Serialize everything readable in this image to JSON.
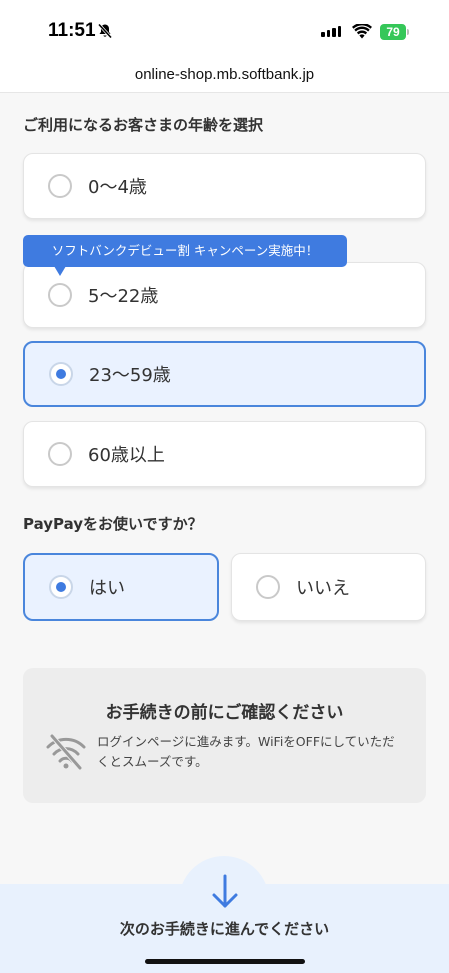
{
  "status_bar": {
    "time": "11:51",
    "battery": "79"
  },
  "browser": {
    "url": "online-shop.mb.softbank.jp"
  },
  "age_section": {
    "title": "ご利用になるお客さまの年齢を選択",
    "options": [
      {
        "label": "0〜4歳",
        "selected": false
      },
      {
        "label": "5〜22歳",
        "selected": false
      },
      {
        "label": "23〜59歳",
        "selected": true
      },
      {
        "label": "60歳以上",
        "selected": false
      }
    ],
    "promo_tooltip": "ソフトバンクデビュー割 キャンペーン実施中！"
  },
  "paypay_section": {
    "title": "PayPayをお使いですか？",
    "options": [
      {
        "label": "はい",
        "selected": true
      },
      {
        "label": "いいえ",
        "selected": false
      }
    ]
  },
  "notice": {
    "title": "お手続きの前にご確認ください",
    "body": "ログインページに進みます。WiFiをOFFにしていただくとスムーズです。",
    "icon": "wifi-off-icon"
  },
  "footer": {
    "label": "次のお手続きに進んでください",
    "icon": "arrow-down-icon"
  },
  "colors": {
    "accent": "#3f7be0",
    "selected_bg": "#eaf2ff",
    "battery": "#35c759"
  }
}
